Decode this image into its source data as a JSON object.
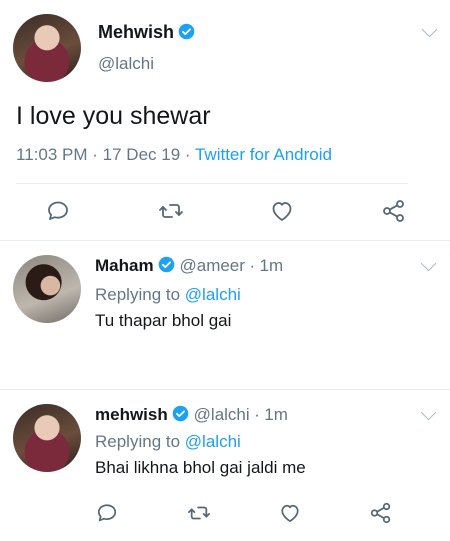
{
  "tweet": {
    "author_name": "Mehwish",
    "author_handle": "@lalchi",
    "text": "I love you shewar",
    "time": "11:03 PM",
    "sep": "·",
    "date": "17 Dec 19",
    "source": "Twitter for Android"
  },
  "replies": [
    {
      "name": "Maham",
      "handle": "@ameer",
      "age": "1m",
      "replying_prefix": "Replying to",
      "replying_to": "@lalchi",
      "text": "Tu thapar bhol gai"
    },
    {
      "name": "mehwish",
      "handle": "@lalchi",
      "age": "1m",
      "replying_prefix": "Replying to",
      "replying_to": "@lalchi",
      "text": "Bhai likhna bhol gai jaldi me"
    }
  ],
  "icons": {
    "reply": "reply-icon",
    "retweet": "retweet-icon",
    "like": "heart-icon",
    "share": "share-icon",
    "verified": "verified-badge-icon",
    "more": "chevron-down-icon"
  },
  "colors": {
    "link": "#1da1f2",
    "secondary": "#657786",
    "divider": "#e6ecf0"
  }
}
